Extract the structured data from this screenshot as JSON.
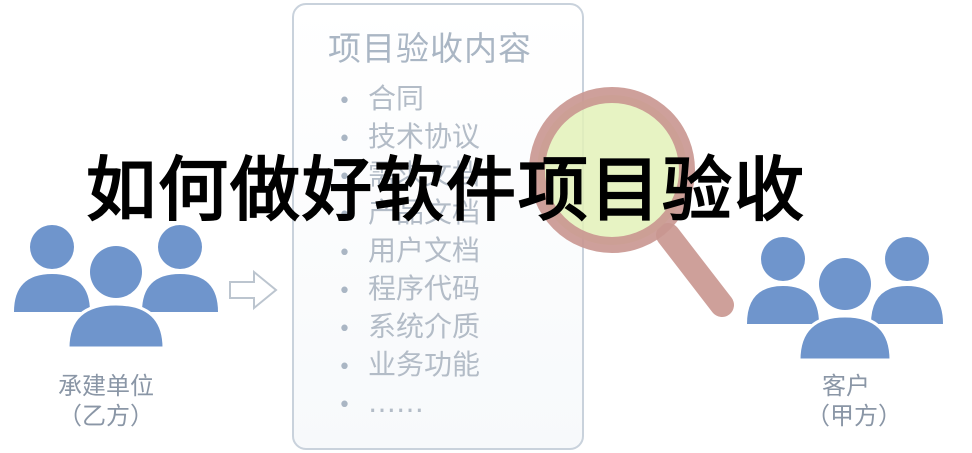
{
  "panel": {
    "title": "项目验收内容",
    "items": [
      "合同",
      "技术协议",
      "需求文档",
      "产品文档",
      "用户文档",
      "程序代码",
      "系统介质",
      "业务功能",
      "……"
    ]
  },
  "headline": "如何做好软件项目验收",
  "contractor": {
    "name": "承建单位",
    "role": "（乙方）"
  },
  "client": {
    "name": "客户",
    "role": "（甲方）"
  },
  "colors": {
    "people": "#6f95cc",
    "magnifier_ring": "#c99690",
    "magnifier_lens": "#e3f1b8",
    "panel_border": "#c9d2dc",
    "text_muted": "#b3bcc7"
  },
  "icons": [
    "people-group-icon",
    "magnifier-icon",
    "arrow-right-icon"
  ]
}
